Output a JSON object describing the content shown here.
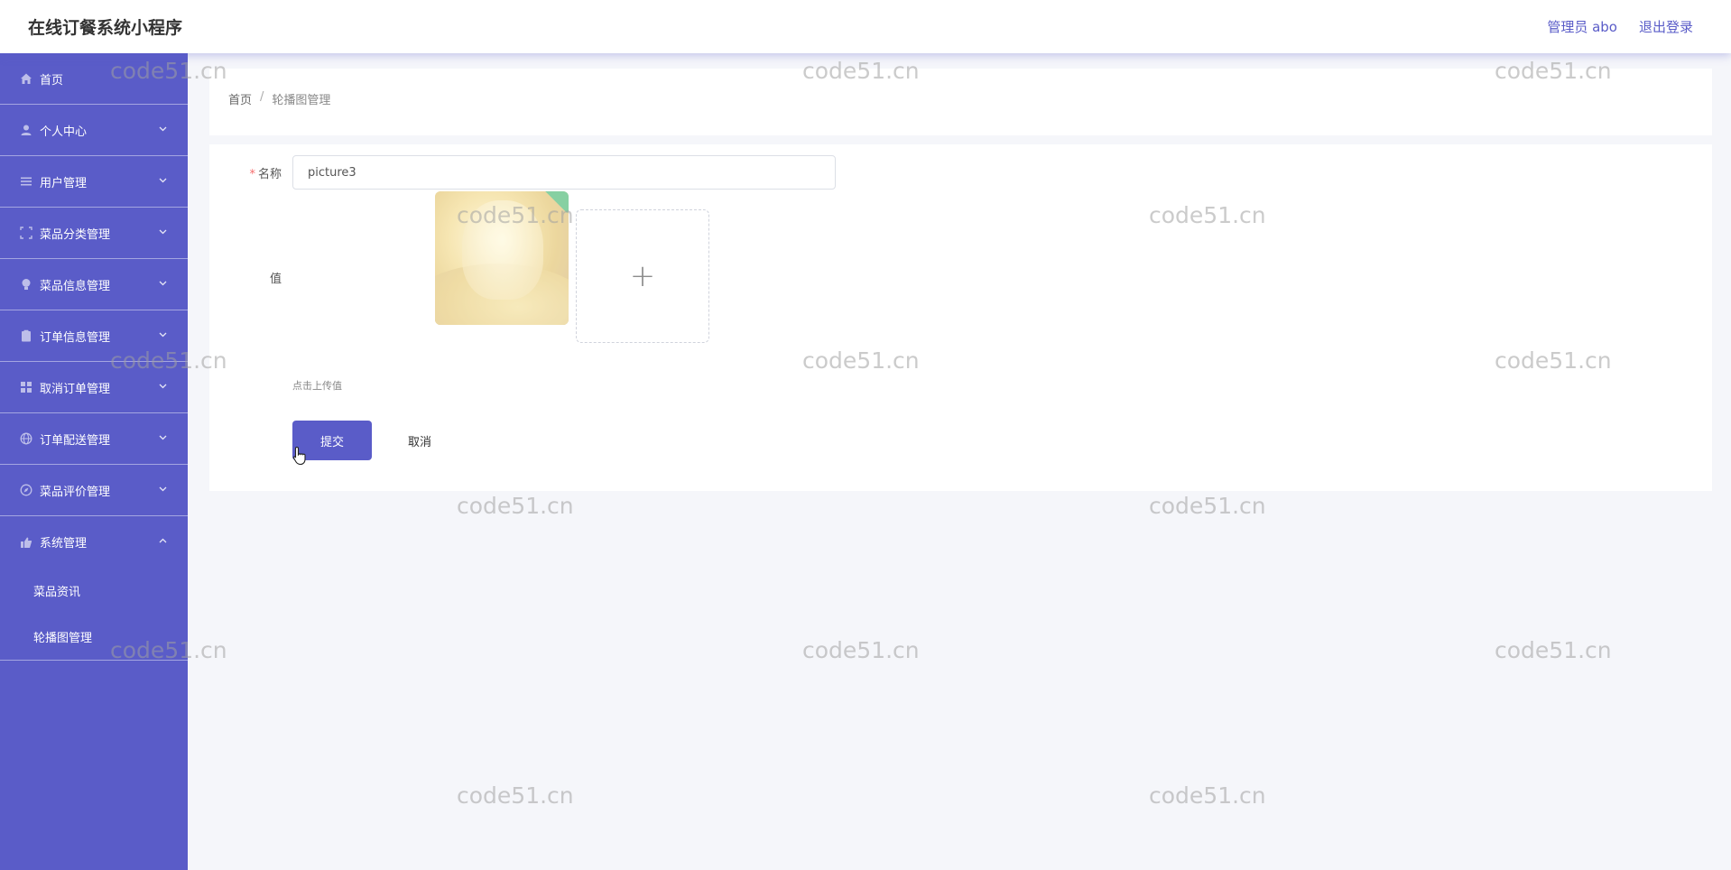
{
  "header": {
    "title": "在线订餐系统小程序",
    "user_label": "管理员 abo",
    "logout_label": "退出登录"
  },
  "sidebar": {
    "items": [
      {
        "label": "首页",
        "icon": "home-icon",
        "expandable": false
      },
      {
        "label": "个人中心",
        "icon": "user-icon",
        "expandable": true
      },
      {
        "label": "用户管理",
        "icon": "list-icon",
        "expandable": true
      },
      {
        "label": "菜品分类管理",
        "icon": "frame-icon",
        "expandable": true
      },
      {
        "label": "菜品信息管理",
        "icon": "bulb-icon",
        "expandable": true
      },
      {
        "label": "订单信息管理",
        "icon": "clipboard-icon",
        "expandable": true
      },
      {
        "label": "取消订单管理",
        "icon": "grid-icon",
        "expandable": true
      },
      {
        "label": "订单配送管理",
        "icon": "globe-icon",
        "expandable": true
      },
      {
        "label": "菜品评价管理",
        "icon": "compass-icon",
        "expandable": true
      },
      {
        "label": "系统管理",
        "icon": "thumb-icon",
        "expandable": true,
        "expanded": true
      }
    ],
    "subitems": [
      {
        "label": "菜品资讯"
      },
      {
        "label": "轮播图管理"
      }
    ]
  },
  "breadcrumb": {
    "home": "首页",
    "separator": "/",
    "current": "轮播图管理"
  },
  "form": {
    "name_label": "名称",
    "name_value": "picture3",
    "value_label": "值",
    "upload_hint": "点击上传值",
    "upload_plus": "+",
    "submit_label": "提交",
    "cancel_label": "取消"
  },
  "watermark": "code51.cn",
  "colors": {
    "accent": "#5a5cc8",
    "required": "#f56c6c",
    "background": "#f5f6fa"
  }
}
